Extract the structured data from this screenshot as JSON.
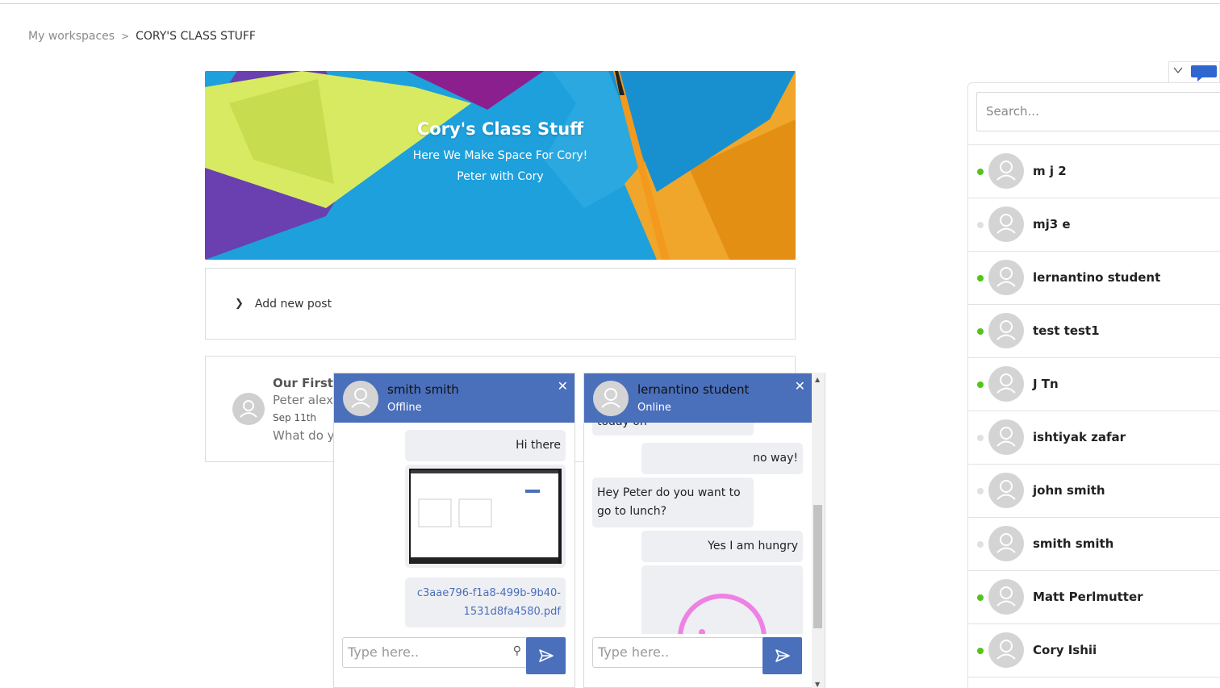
{
  "breadcrumb": {
    "root": "My workspaces",
    "separator": ">",
    "current": "CORY'S CLASS STUFF"
  },
  "banner": {
    "title": "Cory's Class Stuff",
    "subtitle": "Here We Make Space For Cory!",
    "author_line": "Peter with Cory"
  },
  "add_post": {
    "label": "Add new post"
  },
  "post": {
    "title": "Our First I",
    "author": "Peter alex",
    "date": "Sep 11th",
    "body": "What do y"
  },
  "chat1": {
    "name": "smith smith",
    "status": "Offline",
    "messages": [
      "Hi there"
    ],
    "attachment_label": [
      "c3aae796-f1a8-499b-9b40-",
      "1531d8fa4580.pdf"
    ],
    "placeholder": "Type here.."
  },
  "chat2": {
    "name": "lernantino student",
    "status": "Online",
    "messages": [
      "today on",
      "no way!",
      "Hey Peter do you want to",
      "go to lunch?",
      "Yes I am hungry"
    ],
    "placeholder": "Type here.."
  },
  "search": {
    "placeholder": "Search..."
  },
  "users": [
    {
      "name": "m j 2",
      "online": true
    },
    {
      "name": "mj3 e",
      "online": false
    },
    {
      "name": "lernantino student",
      "online": true
    },
    {
      "name": "test test1",
      "online": true
    },
    {
      "name": "J Tn",
      "online": true
    },
    {
      "name": "ishtiyak zafar",
      "online": false
    },
    {
      "name": "john smith",
      "online": false
    },
    {
      "name": "smith smith",
      "online": false
    },
    {
      "name": "Matt Perlmutter",
      "online": true
    },
    {
      "name": "Cory Ishii",
      "online": true
    }
  ],
  "colors": {
    "accent": "#4a6fbb",
    "online": "#52c41a",
    "offline": "#e0e0e0",
    "banner_bg": "#1da0dc"
  }
}
